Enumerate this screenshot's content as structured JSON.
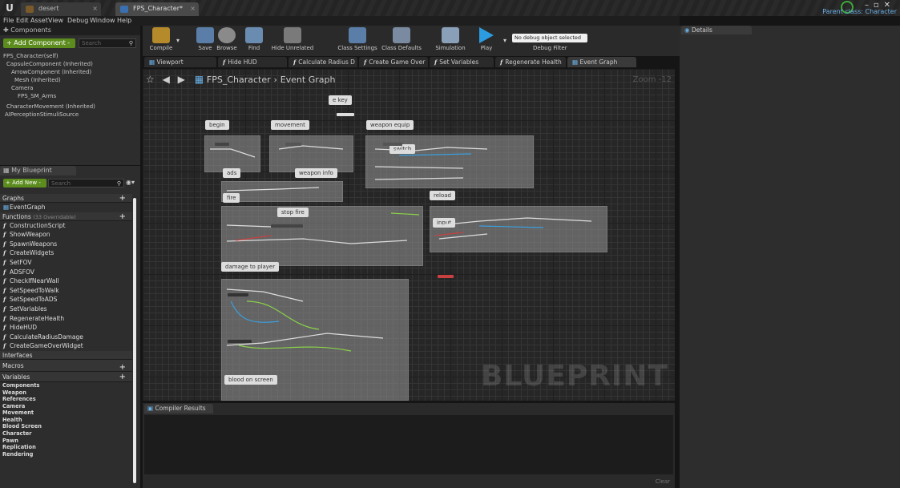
{
  "tabs": [
    {
      "label": "desert"
    },
    {
      "label": "FPS_Character*"
    }
  ],
  "parent_class": "Parent class: Character",
  "menu": [
    "File",
    "Edit",
    "Asset",
    "View",
    "Debug",
    "Window",
    "Help"
  ],
  "components": {
    "header": "Components",
    "add_button": "+ Add Component -",
    "search_placeholder": "Search",
    "items": [
      "FPS_Character(self)",
      "CapsuleComponent (Inherited)",
      "ArrowComponent (Inherited)",
      "Mesh (Inherited)",
      "Camera",
      "FPS_SM_Arms",
      "CharacterMovement (Inherited)",
      "AIPerceptionStimuliSource"
    ]
  },
  "myblueprint": {
    "header": "My Blueprint",
    "add_button": "+ Add New -",
    "search_placeholder": "Search",
    "graphs_label": "Graphs",
    "event_graph": "EventGraph",
    "functions_label": "Functions",
    "functions_override": "(33 Overridable)",
    "functions": [
      "ConstructionScript",
      "ShowWeapon",
      "SpawnWeapons",
      "CreateWidgets",
      "SetFOV",
      "ADSFOV",
      "CheckIfNearWall",
      "SetSpeedToWalk",
      "SetSpeedToADS",
      "SetVariables",
      "RegenerateHealth",
      "HideHUD",
      "CalculateRadiusDamage",
      "CreateGameOverWidget"
    ],
    "interfaces_label": "Interfaces",
    "macros_label": "Macros",
    "variables_label": "Variables",
    "categories": [
      "Components",
      "Weapon",
      "References",
      "Camera",
      "Movement",
      "Health",
      "Blood Screen",
      "Character",
      "Pawn",
      "Replication",
      "Rendering"
    ]
  },
  "toolbar": {
    "buttons": [
      "Compile",
      "Save",
      "Browse",
      "Find",
      "Hide Unrelated",
      "Class Settings",
      "Class Defaults",
      "Simulation",
      "Play"
    ],
    "debug_select": "No debug object selected",
    "debug_filter": "Debug Filter"
  },
  "graph_tabs": [
    "Viewport",
    "Hide HUD",
    "Calculate Radius D",
    "Create Game Over",
    "Set Variables",
    "Regenerate Health",
    "Event Graph"
  ],
  "breadcrumb": {
    "class": "FPS_Character",
    "graph": "Event Graph"
  },
  "zoom": "Zoom -12",
  "comments": [
    "e key",
    "begin",
    "movement",
    "weapon equip",
    "switch",
    "ads",
    "weapon info",
    "fire",
    "reload",
    "stop fire",
    "input",
    "damage to player",
    "blood on screen"
  ],
  "watermark": "BLUEPRINT",
  "compiler": {
    "header": "Compiler Results",
    "clear": "Clear"
  },
  "details": {
    "header": "Details"
  },
  "colors": {
    "accent": "#5c8c1e",
    "link": "#6ab1e8",
    "play": "#2d9be0"
  }
}
